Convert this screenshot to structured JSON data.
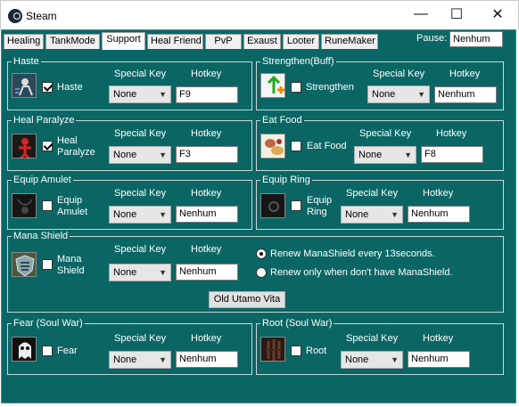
{
  "window": {
    "title": "Steam",
    "minimize_glyph": "—",
    "maximize_glyph": "☐",
    "close_glyph": "✕"
  },
  "tabs": [
    "Healing",
    "TankMode",
    "Support",
    "Heal Friend",
    "PvP",
    "Exaust",
    "Looter",
    "RuneMaker"
  ],
  "active_tab": "Support",
  "pause": {
    "label": "Pause:",
    "value": "Nenhum"
  },
  "columns": {
    "special_key": "Special Key",
    "hotkey": "Hotkey"
  },
  "panels": {
    "haste": {
      "title": "Haste",
      "label": "Haste",
      "checked": true,
      "special_key": "None",
      "hotkey": "F9",
      "icon": "haste-icon"
    },
    "strengthen": {
      "title": "Strengthen(Buff)",
      "label": "Strengthen",
      "checked": false,
      "special_key": "None",
      "hotkey": "Nenhum",
      "icon": "strengthen-icon"
    },
    "heal_paralyze": {
      "title": "Heal Paralyze",
      "label_line1": "Heal",
      "label_line2": "Paralyze",
      "checked": true,
      "special_key": "None",
      "hotkey": "F3",
      "icon": "heal-paralyze-icon"
    },
    "eat_food": {
      "title": "Eat Food",
      "label": "Eat Food",
      "checked": false,
      "special_key": "None",
      "hotkey": "F8",
      "icon": "food-icon"
    },
    "equip_amulet": {
      "title": "Equip Amulet",
      "label_line1": "Equip",
      "label_line2": "Amulet",
      "checked": false,
      "special_key": "None",
      "hotkey": "Nenhum",
      "icon": "amulet-icon"
    },
    "equip_ring": {
      "title": "Equip Ring",
      "label_line1": "Equip",
      "label_line2": "Ring",
      "checked": false,
      "special_key": "None",
      "hotkey": "Nenhum",
      "icon": "ring-icon"
    },
    "mana_shield": {
      "title": "Mana Shield",
      "label_line1": "Mana",
      "label_line2": "Shield",
      "checked": false,
      "special_key": "None",
      "hotkey": "Nenhum",
      "icon": "mana-shield-icon",
      "radio1": "Renew ManaShield every 13seconds.",
      "radio2": "Renew only when don't have ManaShield.",
      "radio_selected": 1,
      "button": "Old Utamo Vita"
    },
    "fear": {
      "title": "Fear (Soul War)",
      "label": "Fear",
      "checked": false,
      "special_key": "None",
      "hotkey": "Nenhum",
      "icon": "fear-icon"
    },
    "root": {
      "title": "Root (Soul War)",
      "label": "Root",
      "checked": false,
      "special_key": "None",
      "hotkey": "Nenhum",
      "icon": "root-icon"
    }
  },
  "colors": {
    "background": "#0a6664",
    "text": "#ffffff",
    "panel_border": "#c9d8d7"
  }
}
